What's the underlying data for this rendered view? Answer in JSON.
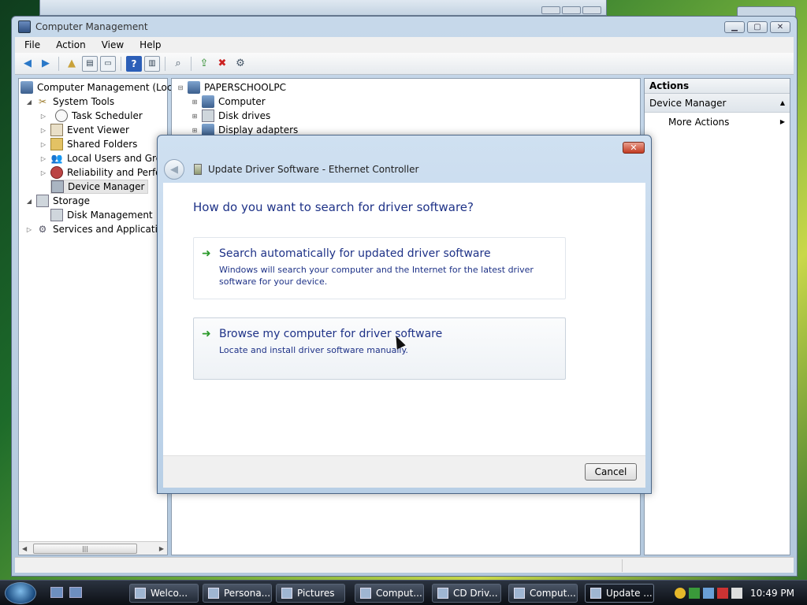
{
  "window": {
    "title": "Computer Management",
    "menu": [
      "File",
      "Action",
      "View",
      "Help"
    ]
  },
  "tree": {
    "root": "Computer Management (Local",
    "system_tools": "System Tools",
    "task_scheduler": "Task Scheduler",
    "event_viewer": "Event Viewer",
    "shared_folders": "Shared Folders",
    "local_users": "Local Users and Group",
    "reliability": "Reliability and Perform",
    "device_manager": "Device Manager",
    "storage": "Storage",
    "disk_management": "Disk Management",
    "services": "Services and Applications"
  },
  "devices": {
    "pc": "PAPERSCHOOLPC",
    "items": [
      "Computer",
      "Disk drives",
      "Display adapters"
    ]
  },
  "actions": {
    "header": "Actions",
    "section": "Device Manager",
    "more": "More Actions"
  },
  "dialog": {
    "title": "Update Driver Software - Ethernet Controller",
    "question": "How do you want to search for driver software?",
    "option1_title": "Search automatically for updated driver software",
    "option1_desc": "Windows will search your computer and the Internet for the latest driver software for your device.",
    "option2_title": "Browse my computer for driver software",
    "option2_desc": "Locate and install driver software manually.",
    "cancel": "Cancel",
    "close_glyph": "✕"
  },
  "taskbar": {
    "tasks": [
      "Welco...",
      "Persona...",
      "Pictures",
      "Comput...",
      "CD Driv...",
      "Comput...",
      "Update ..."
    ],
    "clock": "10:49 PM"
  }
}
